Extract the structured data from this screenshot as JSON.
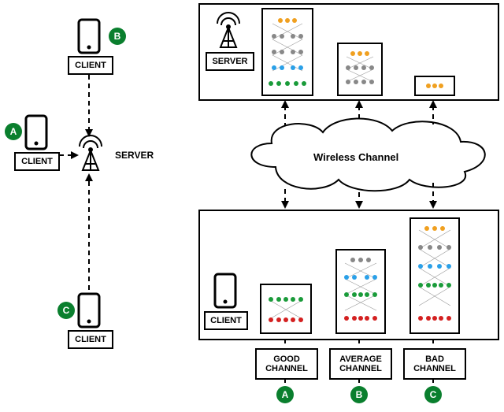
{
  "left": {
    "clientA": {
      "label": "CLIENT",
      "badge": "A"
    },
    "clientB": {
      "label": "CLIENT",
      "badge": "B"
    },
    "clientC": {
      "label": "CLIENT",
      "badge": "C"
    },
    "server_label": "SERVER"
  },
  "right": {
    "server_label": "SERVER",
    "client_label": "CLIENT",
    "cloud_label": "Wireless Channel",
    "channels": [
      {
        "line1": "GOOD",
        "line2": "CHANNEL",
        "badge": "A"
      },
      {
        "line1": "AVERAGE",
        "line2": "CHANNEL",
        "badge": "B"
      },
      {
        "line1": "BAD",
        "line2": "CHANNEL",
        "badge": "C"
      }
    ]
  },
  "chart_data": {
    "type": "diagram",
    "title": "Channel-aware split of neural-network layers between clients and server",
    "left_panel": {
      "server": 1,
      "clients": [
        "A",
        "B",
        "C"
      ],
      "links": [
        {
          "from": "A",
          "to": "server"
        },
        {
          "from": "B",
          "to": "server"
        },
        {
          "from": "C",
          "to": "server"
        }
      ]
    },
    "right_panel": {
      "medium": "Wireless Channel",
      "total_nn_layers": 6,
      "cases": [
        {
          "id": "A",
          "channel_quality": "GOOD",
          "client_layers": 2,
          "server_layers": 4
        },
        {
          "id": "B",
          "channel_quality": "AVERAGE",
          "client_layers": 4,
          "server_layers": 2
        },
        {
          "id": "C",
          "channel_quality": "BAD",
          "client_layers": 5,
          "server_layers": 1
        }
      ]
    }
  }
}
